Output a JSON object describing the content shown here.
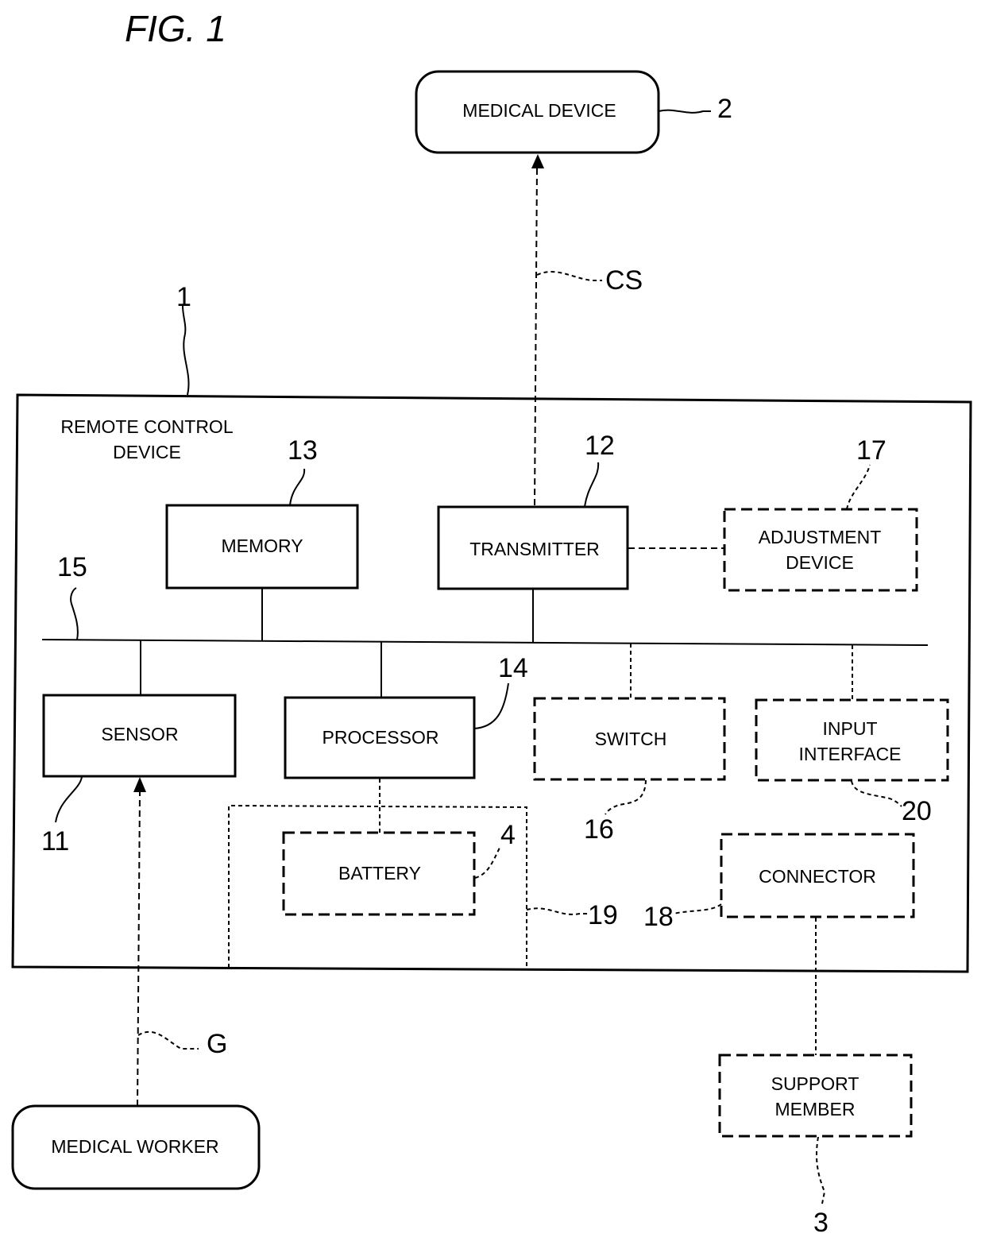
{
  "figure": {
    "title": "FIG. 1"
  },
  "external": {
    "medical_device": {
      "label": "MEDICAL DEVICE",
      "ref": "2"
    },
    "medical_worker": {
      "label": "MEDICAL WORKER"
    },
    "support_member": {
      "label_line1": "SUPPORT",
      "label_line2": "MEMBER",
      "ref": "3"
    }
  },
  "signals": {
    "control_signal": "CS",
    "gesture": "G"
  },
  "remote_control_device": {
    "label_line1": "REMOTE CONTROL",
    "label_line2": "DEVICE",
    "ref": "1",
    "bus_ref": "15",
    "components": {
      "sensor": {
        "label": "SENSOR",
        "ref": "11"
      },
      "transmitter": {
        "label": "TRANSMITTER",
        "ref": "12"
      },
      "memory": {
        "label": "MEMORY",
        "ref": "13"
      },
      "processor": {
        "label": "PROCESSOR",
        "ref": "14"
      },
      "switch": {
        "label": "SWITCH",
        "ref": "16"
      },
      "adjustment_device": {
        "label_line1": "ADJUSTMENT",
        "label_line2": "DEVICE",
        "ref": "17"
      },
      "connector": {
        "label": "CONNECTOR",
        "ref": "18"
      },
      "battery_housing": {
        "ref": "19"
      },
      "input_interface": {
        "label_line1": "INPUT",
        "label_line2": "INTERFACE",
        "ref": "20"
      },
      "battery": {
        "label": "BATTERY",
        "ref": "4"
      }
    }
  }
}
